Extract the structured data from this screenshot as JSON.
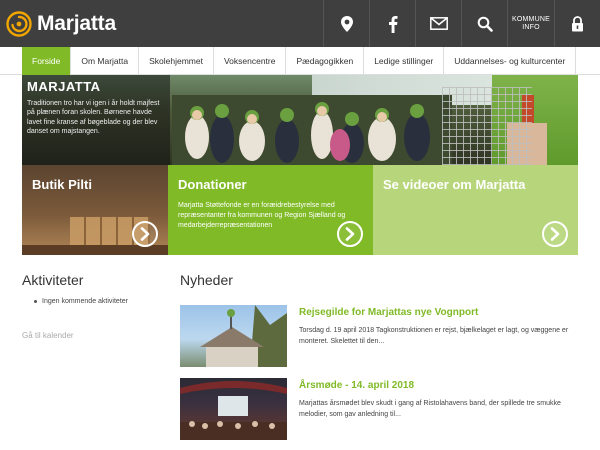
{
  "header": {
    "logo_text": "Marjatta",
    "logo_icon": "swirl-logo-icon",
    "icons": [
      "location-pin-icon",
      "facebook-icon",
      "mail-icon",
      "search-icon",
      "kommune-info",
      "lock-icon"
    ],
    "kommune_label_line1": "KOMMUNE",
    "kommune_label_line2": "INFO",
    "colors": {
      "bar": "#3f3f3f",
      "accent": "#f0a500"
    }
  },
  "nav": {
    "items": [
      {
        "label": "Forside",
        "active": true
      },
      {
        "label": "Om Marjatta",
        "active": false
      },
      {
        "label": "Skolehjemmet",
        "active": false
      },
      {
        "label": "Voksencentre",
        "active": false
      },
      {
        "label": "Pædagogikken",
        "active": false
      },
      {
        "label": "Ledige stillinger",
        "active": false
      },
      {
        "label": "Uddannelses- og kulturcenter",
        "active": false
      }
    ],
    "active_color": "#80ba27"
  },
  "hero": {
    "title": "MARJATTA",
    "text": "Traditionen tro har vi igen i år holdt majfest på plænen foran skolen. Børnene havde lavet fine kranse af bøgeblade og der blev danset om majstangen."
  },
  "tiles": [
    {
      "title": "Butik Pilti",
      "text": "",
      "icon": "arrow-right-circle-icon"
    },
    {
      "title": "Donationer",
      "text": "Marjatta Støttefonde er en foræidrebestyrelse med repræsentanter fra kommunen og Region Sjælland og medarbejderrepræsentationen",
      "icon": "arrow-right-circle-icon"
    },
    {
      "title": "Se videoer om Marjatta",
      "text": "",
      "icon": "arrow-right-circle-icon"
    }
  ],
  "activities": {
    "heading": "Aktiviteter",
    "items": [
      "Ingen kommende aktiviteter"
    ],
    "calendar_link": "Gå til kalender"
  },
  "news": {
    "heading": "Nyheder",
    "items": [
      {
        "title": "Rejsegilde for Marjattas nye Vognport",
        "text": "Torsdag d. 19 april 2018 Tagkonstruktionen er rejst, bjælkelaget er lagt, og væggene er monteret. Skelettet til den..."
      },
      {
        "title": "Årsmøde - 14. april 2018",
        "text": "Marjattas årsmødet blev skudt i gang af Ristolahavens band, der spillede tre smukke melodier, som gav anledning til..."
      }
    ]
  }
}
